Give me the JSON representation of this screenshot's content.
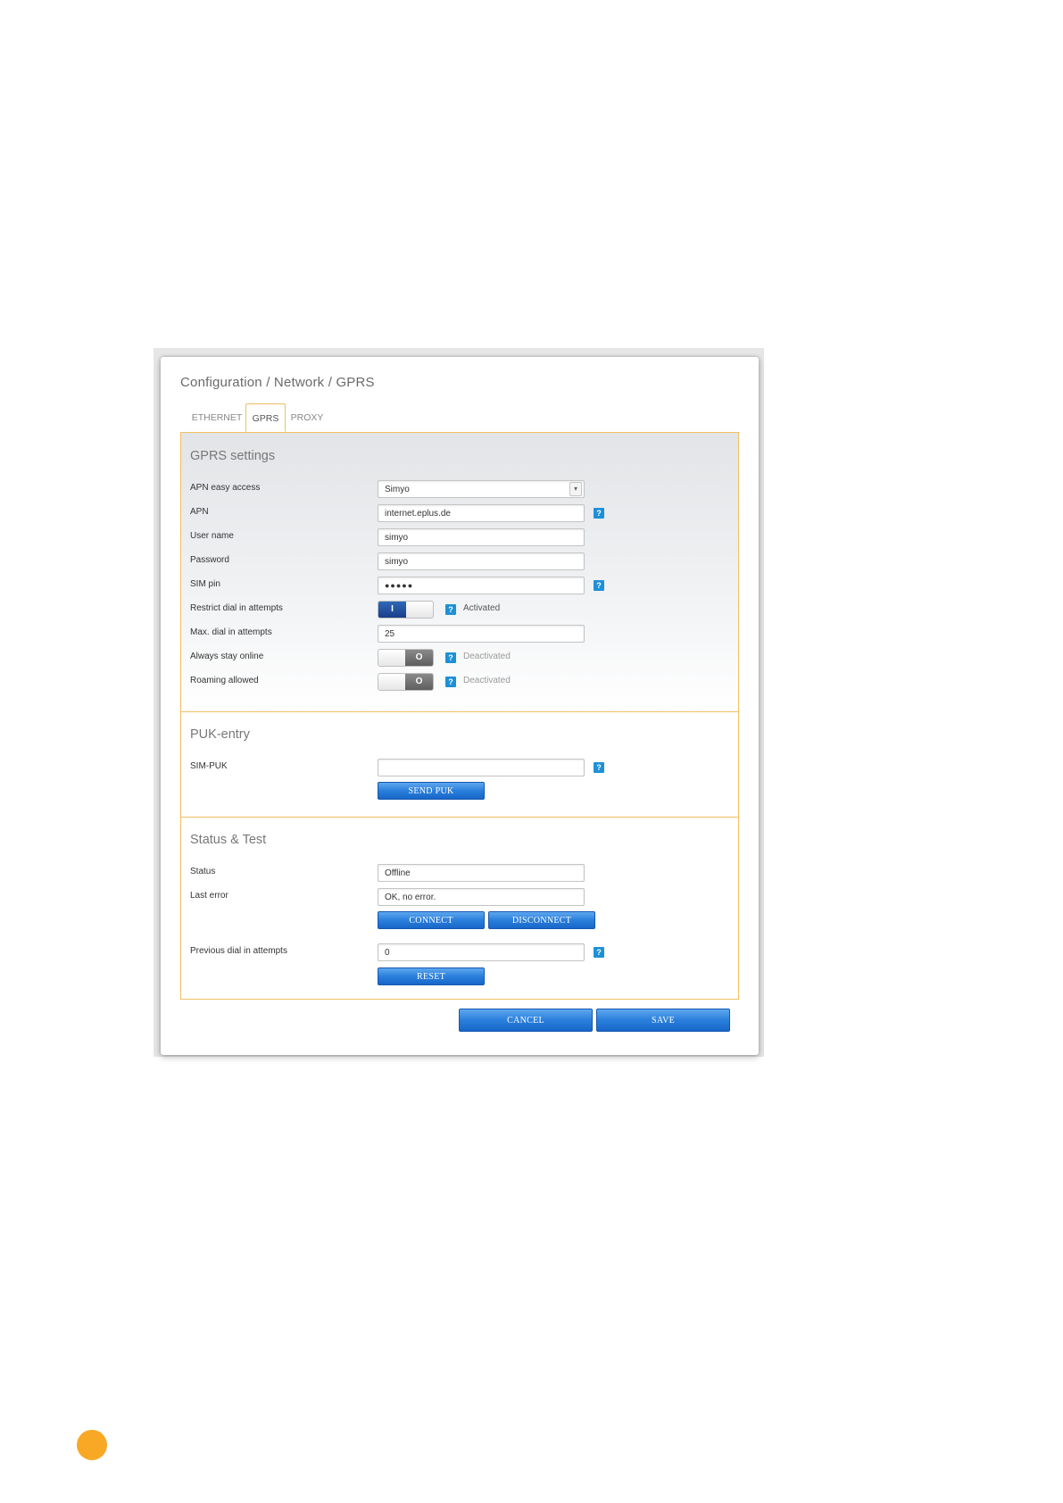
{
  "breadcrumb": "Configuration / Network / GPRS",
  "tabs": [
    {
      "label": "ETHERNET",
      "active": false
    },
    {
      "label": "GPRS",
      "active": true
    },
    {
      "label": "PROXY",
      "active": false
    }
  ],
  "gprs": {
    "title": "GPRS settings",
    "apn_easy_access": {
      "label": "APN easy access",
      "value": "Simyo"
    },
    "apn": {
      "label": "APN",
      "value": "internet.eplus.de"
    },
    "user_name": {
      "label": "User name",
      "value": "simyo"
    },
    "password": {
      "label": "Password",
      "value": "simyo"
    },
    "sim_pin": {
      "label": "SIM pin",
      "value": "●●●●●"
    },
    "restrict_dial": {
      "label": "Restrict dial in attempts",
      "knob": "I",
      "state": "Activated"
    },
    "max_dial": {
      "label": "Max. dial in attempts",
      "value": "25"
    },
    "always_online": {
      "label": "Always stay online",
      "knob": "O",
      "state": "Deactivated"
    },
    "roaming": {
      "label": "Roaming allowed",
      "knob": "O",
      "state": "Deactivated"
    }
  },
  "puk": {
    "title": "PUK-entry",
    "sim_puk": {
      "label": "SIM-PUK",
      "value": ""
    },
    "send_label": "SEND PUK"
  },
  "status_test": {
    "title": "Status & Test",
    "status": {
      "label": "Status",
      "value": "Offline"
    },
    "last_error": {
      "label": "Last error",
      "value": "OK, no error."
    },
    "connect_label": "CONNECT",
    "disconnect_label": "DISCONNECT",
    "previous_dial": {
      "label": "Previous dial in attempts",
      "value": "0"
    },
    "reset_label": "RESET"
  },
  "footer": {
    "cancel_label": "CANCEL",
    "save_label": "SAVE"
  },
  "help_glyph": "?",
  "dropdown_glyph": "▾",
  "colors": {
    "accent_border": "#f0c060",
    "button_blue": "#2a7fdc",
    "help_blue": "#1e90d8",
    "page_marker": "#f9a825"
  }
}
